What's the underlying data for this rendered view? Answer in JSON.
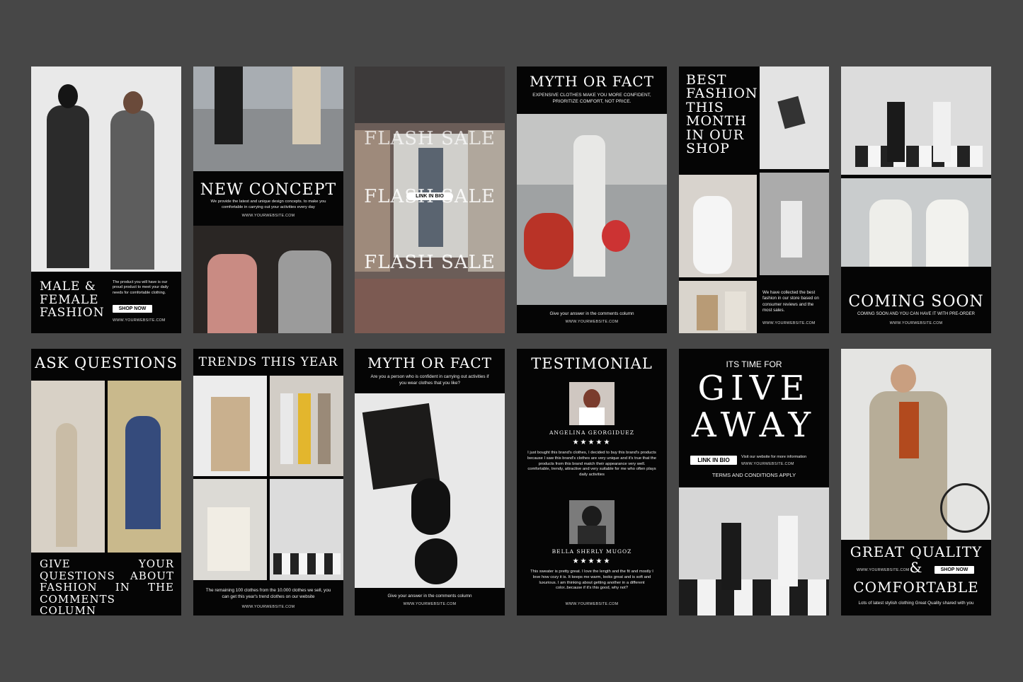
{
  "cards": {
    "c1": {
      "title": "MALE & FEMALE FASHION",
      "desc": "The product you will have is our proud product to meet your daily needs for comfortable clothing.",
      "button": "SHOP NOW",
      "website": "WWW.YOURWEBSITE.COM"
    },
    "c2": {
      "title": "NEW CONCEPT",
      "desc": "We provide the latest and unique design concepts. to make you comfortable in carrying out your activities every day",
      "website": "WWW.YOURWEBSITE.COM"
    },
    "c3": {
      "title": "FLASH SALE",
      "button": "LINK IN BIO"
    },
    "c4": {
      "title": "MYTH OR FACT",
      "subtitle": "EXPENSIVE CLOTHES MAKE YOU MORE CONFIDENT, PRIORITIZE COMFORT, NOT PRICE.",
      "footer": "Give your answer in the comments column",
      "website": "WWW.YOURWEBSITE.COM"
    },
    "c5": {
      "title": "BEST FASHION THIS MONTH IN OUR SHOP",
      "desc": "We have collected the best fashion in our store based on consumer reviews and the most sales.",
      "website": "WWW.YOURWEBSITE.COM"
    },
    "c6": {
      "title": "COMING SOON",
      "subtitle": "COMING SOON AND YOU CAN HAVE IT WITH PRE-ORDER",
      "website": "WWW.YOURWEBSITE.COM"
    },
    "c7": {
      "title": "ASK QUESTIONS",
      "body": "GIVE YOUR QUESTIONS ABOUT FASHION IN THE COMMENTS COLUMN"
    },
    "c8": {
      "title": "TRENDS THIS YEAR",
      "desc": "The remaining 100 clothes from the 10.000 clothes we sell, you can get this year's trend clothes on our website",
      "website": "WWW.YOURWEBSITE.COM"
    },
    "c9": {
      "title": "MYTH OR FACT",
      "subtitle": "Are you a person who is confident in carrying out activities if you wear clothes that you like?",
      "footer": "Give your answer in the comments column",
      "website": "WWW.YOURWEBSITE.COM"
    },
    "c10": {
      "title": "TESTIMONIAL",
      "name1": "ANGELINA GEORGIDUEZ",
      "stars": "★★★★★",
      "review1": "I just bought this brand's clothes, I decided to buy this brand's products because I saw this brand's clothes are very unique and it's true that the products from this brand match their appearance very well. comfortable, trendy, attractive and very suitable for me who often plays daily activities",
      "name2": "BELLA SHERLY MUGOZ",
      "review2": "This sweater is pretty great. I love the length and the fit and mostly I love how cozy it is. It keeps me warm, looks great and is soft and luxurious. I am thinking about getting another in a different color..because if it's this good, why not?",
      "website": "WWW.YOURWEBSITE.COM"
    },
    "c11": {
      "pre": "ITS TIME FOR",
      "title1": "GIVE",
      "title2": "AWAY",
      "button": "LINK IN BIO",
      "visit": "Visit our website for more information",
      "website": "WWW.YOURWEBSITE.COM",
      "terms": "TERMS AND CONDITIONS APPLY"
    },
    "c12": {
      "title1": "GREAT QUALITY",
      "amp": "&",
      "title2": "COMFORTABLE",
      "website": "WWW.YOURWEBSITE.COM",
      "button": "SHOP NOW",
      "footer": "Lots of latest stylish clothing Great Quality shared with you"
    }
  }
}
